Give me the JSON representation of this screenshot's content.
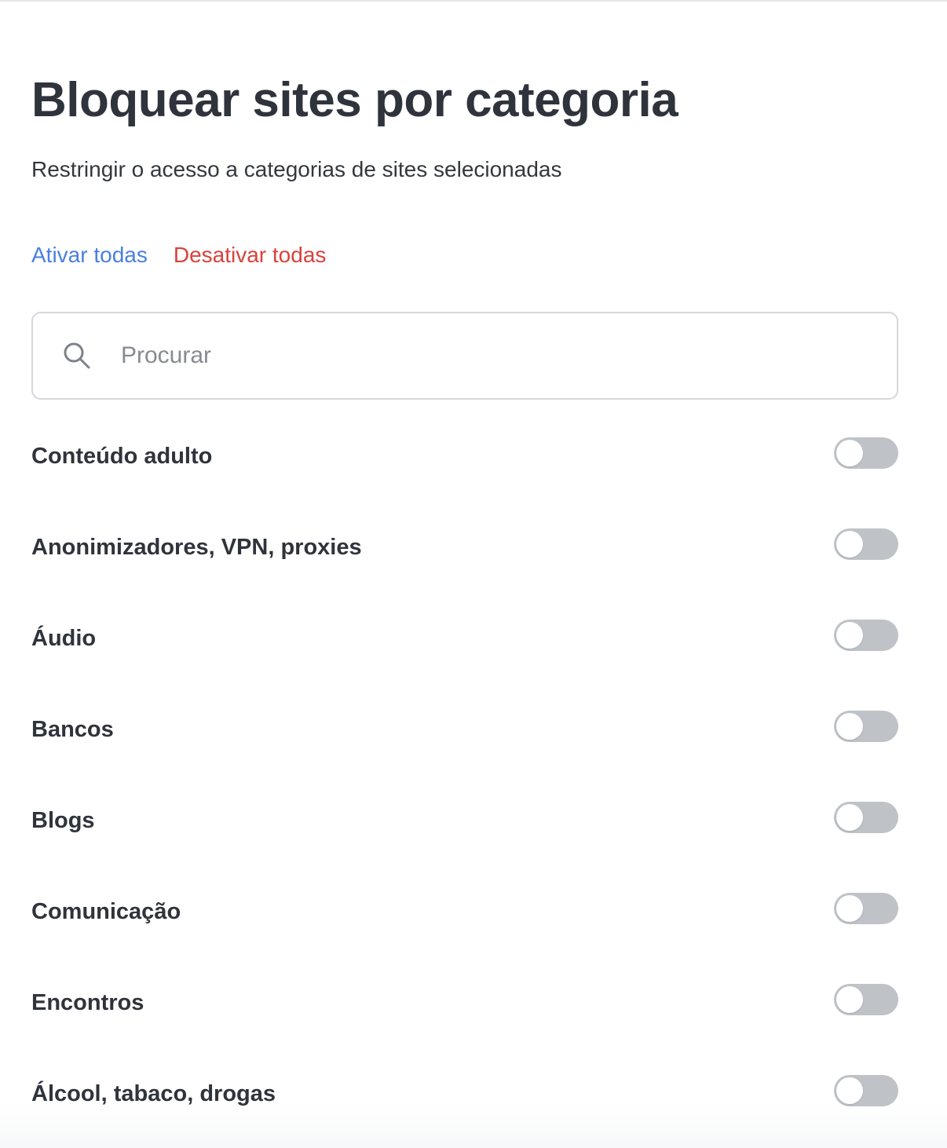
{
  "page": {
    "title": "Bloquear sites por categoria",
    "subtitle": "Restringir o acesso a categorias de sites selecionadas"
  },
  "actions": {
    "enable_all": "Ativar todas",
    "disable_all": "Desativar todas",
    "enable_color": "#4a7fe0",
    "disable_color": "#d9423b"
  },
  "search": {
    "placeholder": "Procurar",
    "value": "",
    "icon": "search-icon"
  },
  "categories": [
    {
      "label": "Conteúdo adulto",
      "enabled": false
    },
    {
      "label": "Anonimizadores, VPN, proxies",
      "enabled": false
    },
    {
      "label": "Áudio",
      "enabled": false
    },
    {
      "label": "Bancos",
      "enabled": false
    },
    {
      "label": "Blogs",
      "enabled": false
    },
    {
      "label": "Comunicação",
      "enabled": false
    },
    {
      "label": "Encontros",
      "enabled": false
    },
    {
      "label": "Álcool, tabaco, drogas",
      "enabled": false
    }
  ],
  "colors": {
    "toggle_off": "#bfc3c8",
    "text_primary": "#2f343c"
  }
}
